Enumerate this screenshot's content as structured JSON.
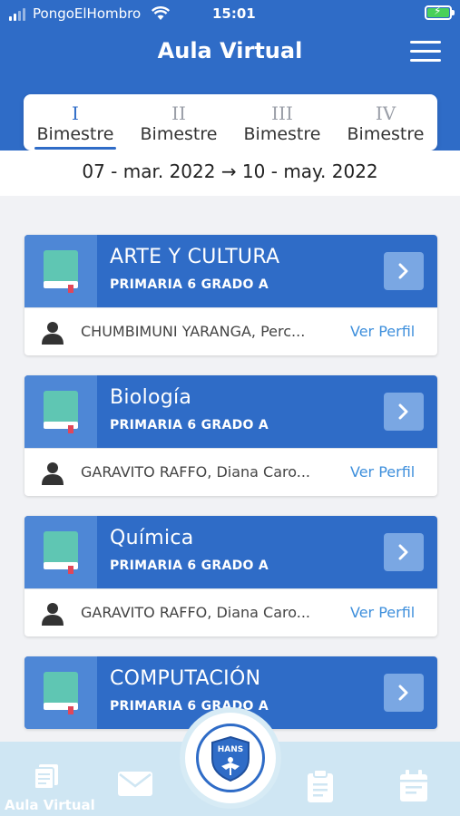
{
  "status_bar": {
    "carrier": "PongoElHombro",
    "time": "15:01"
  },
  "header": {
    "title": "Aula Virtual",
    "menu_icon": "hamburger-menu-icon"
  },
  "tabs": [
    {
      "number": "I",
      "label": "Bimestre",
      "active": true
    },
    {
      "number": "II",
      "label": "Bimestre",
      "active": false
    },
    {
      "number": "III",
      "label": "Bimestre",
      "active": false
    },
    {
      "number": "IV",
      "label": "Bimestre",
      "active": false
    }
  ],
  "date_range": "07 - mar. 2022 → 10 - may. 2022",
  "courses": [
    {
      "name": "ARTE Y CULTURA",
      "grade": "PRIMARIA 6 GRADO A",
      "teacher": "CHUMBIMUNI YARANGA, Perc...",
      "profile_link": "Ver Perfil"
    },
    {
      "name": "Biología",
      "grade": "PRIMARIA 6 GRADO A",
      "teacher": "GARAVITO RAFFO, Diana Caro...",
      "profile_link": "Ver Perfil"
    },
    {
      "name": "Química",
      "grade": "PRIMARIA 6 GRADO A",
      "teacher": "GARAVITO RAFFO, Diana Caro...",
      "profile_link": "Ver Perfil"
    },
    {
      "name": "COMPUTACIÓN",
      "grade": "PRIMARIA 6 GRADO A",
      "teacher": "",
      "profile_link": ""
    }
  ],
  "bottom_nav": {
    "active_label": "Aula Virtual",
    "center_logo_text": "HANS",
    "items": [
      "book-stack-icon",
      "mail-icon",
      "clipboard-icon",
      "calendar-icon"
    ]
  },
  "colors": {
    "primary": "#2f6cc7",
    "book_box": "#4e87d6",
    "link": "#3e8fdc",
    "nav_bg": "#cfe6f3",
    "book_green": "#5fc6b3"
  }
}
